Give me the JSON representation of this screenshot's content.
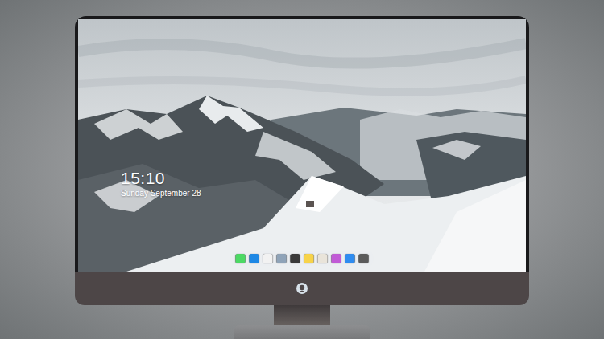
{
  "lock_screen": {
    "time": "15:10",
    "date": "Sunday September 28"
  },
  "dock": {
    "items": [
      {
        "color": "#4cd964"
      },
      {
        "color": "#1e88e5"
      },
      {
        "color": "#f2f2f2"
      },
      {
        "color": "#8fa3b8"
      },
      {
        "color": "#3a3a3a"
      },
      {
        "color": "#f7d34a"
      },
      {
        "color": "#e9e4da"
      },
      {
        "color": "#c15bd6"
      },
      {
        "color": "#2f8cf0"
      },
      {
        "color": "#5b5b5b"
      }
    ]
  }
}
